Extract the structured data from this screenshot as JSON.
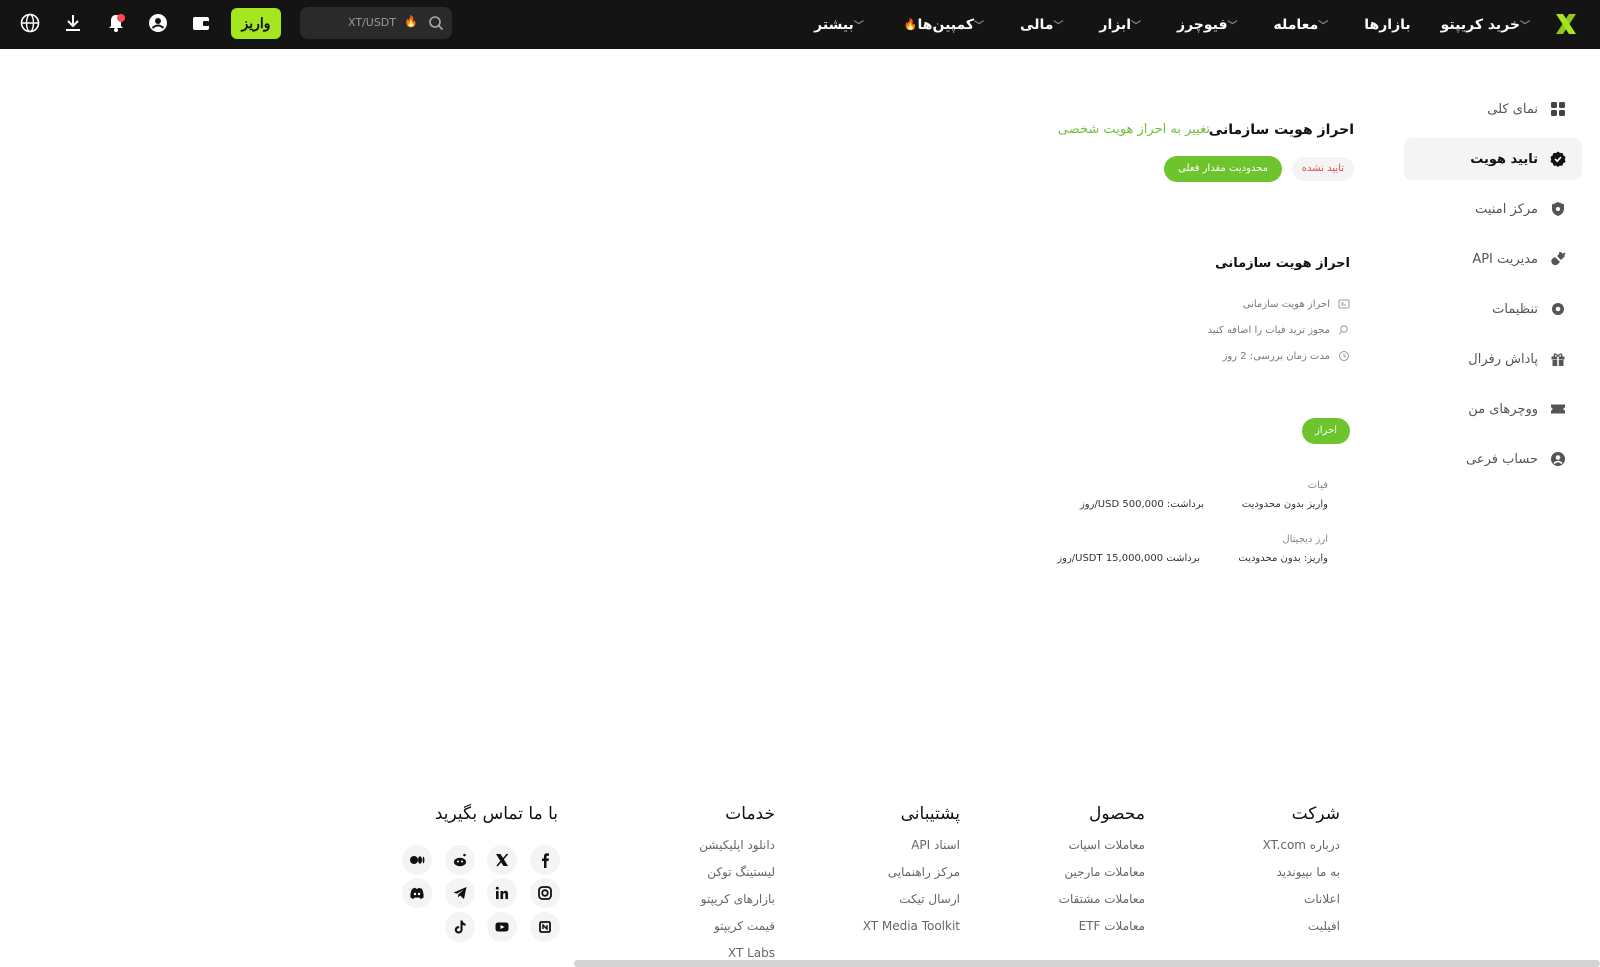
{
  "topbar": {
    "nav": [
      {
        "label": "خرید کریپتو",
        "chevron": true
      },
      {
        "label": "بازارها",
        "chevron": false
      },
      {
        "label": "معامله",
        "chevron": true
      },
      {
        "label": "فیوچرز",
        "chevron": true
      },
      {
        "label": "ابزار",
        "chevron": true
      },
      {
        "label": "مالی",
        "chevron": true
      },
      {
        "label": "کمپین‌ها",
        "chevron": true,
        "fire": true
      },
      {
        "label": "بیشتر",
        "chevron": true
      }
    ],
    "search_text": "XT/USDT",
    "deposit_label": "واریز",
    "accent_color": "#a4e61f"
  },
  "sidebar": {
    "items": [
      {
        "label": "نمای کلی",
        "icon": "grid-icon"
      },
      {
        "label": "تایید هویت",
        "icon": "verified-badge-icon",
        "active": true
      },
      {
        "label": "مرکز امنیت",
        "icon": "shield-icon"
      },
      {
        "label": "مدیریت API",
        "icon": "api-plug-icon"
      },
      {
        "label": "تنظیمات",
        "icon": "gear-icon"
      },
      {
        "label": "پاداش رفرال",
        "icon": "gift-icon"
      },
      {
        "label": "ووچرهای من",
        "icon": "ticket-icon"
      },
      {
        "label": "حساب فرعی",
        "icon": "user-circle-icon"
      }
    ]
  },
  "main": {
    "title": "احراز هویت سازمانی",
    "switch_link": "تغییر به احراز هویت شخصی",
    "status": "تایید نشده",
    "current_limit": "محدودیت مقدار فعلی",
    "card_title": "احراز  هویت سازمانی",
    "requirements": [
      "احراز هویت سازمانی",
      "مجوز ترید فیات را اضافه کنید",
      "مدت زمان بررسی: 2 روز"
    ],
    "verify_button": "احراز",
    "limits": [
      {
        "heading": "فیات",
        "deposit": "واریز بدون محدودیت",
        "withdraw": "برداشت: 500,000 USD/روز"
      },
      {
        "heading": "ارز دیجیتال",
        "deposit": "واریز: بدون محدودیت",
        "withdraw": "برداشت 15,000,000 USDT/روز"
      }
    ]
  },
  "footer": {
    "columns": [
      {
        "title": "شرکت",
        "links": [
          "درباره XT.com",
          "به ما بپیوندید",
          "اعلانات",
          "افیلیت"
        ]
      },
      {
        "title": "محصول",
        "links": [
          "معاملات اسپات",
          "معاملات مارجین",
          "معاملات مشتقات",
          "معاملات ETF"
        ]
      },
      {
        "title": "پشتیبانی",
        "links": [
          "اسناد API",
          "مرکز راهنمایی",
          "ارسال تیکت",
          "XT Media Toolkit"
        ]
      },
      {
        "title": "خدمات",
        "links": [
          "دانلود اپلیکیشن",
          "لیستینگ توکن",
          "بازارهای کریپتو",
          "قیمت کریپتو",
          "XT Labs"
        ]
      }
    ],
    "contact_title": "با ما تماس بگیرید"
  }
}
